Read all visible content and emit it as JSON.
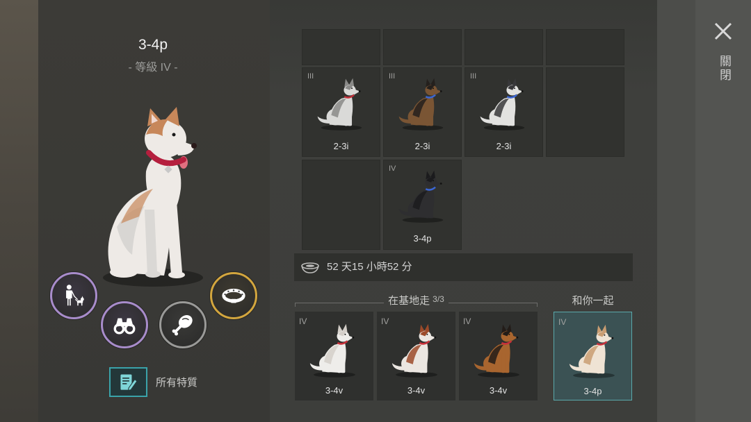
{
  "selected_dog": {
    "name": "3-4p",
    "level": "- 等級 IV -",
    "coat": "#eeeae6",
    "accent": "#c7875a",
    "collar": "#b51f3e"
  },
  "actions": [
    {
      "icon": "walk-with-dog-icon",
      "ring": "#a88ccb",
      "fill": "#3c3742"
    },
    {
      "icon": "binoculars-icon",
      "ring": "#a88ccb",
      "fill": "#3c3742"
    },
    {
      "icon": "meat-icon",
      "ring": "#9a9a98",
      "fill": "#3a3a38"
    },
    {
      "icon": "collar-icon",
      "ring": "#d3a63e",
      "fill": "#3e3a30"
    }
  ],
  "traits": {
    "icon": "notes-edit-icon",
    "label": "所有特質"
  },
  "kennel": {
    "rows": [
      [
        {
          "empty": true
        },
        {
          "empty": true
        },
        {
          "empty": true
        },
        {
          "empty": true
        }
      ],
      [
        {
          "tier": "III",
          "name": "2-3i",
          "coat": "#dadad8",
          "accent": "#8a8a88",
          "collar": "#c0303a"
        },
        {
          "tier": "III",
          "name": "2-3i",
          "coat": "#7a5534",
          "accent": "#24201d",
          "collar": "#3b66d4"
        },
        {
          "tier": "III",
          "name": "2-3i",
          "coat": "#e2e2e0",
          "accent": "#38383a",
          "collar": "#3b66d4"
        },
        {
          "empty": true
        }
      ],
      [
        {
          "empty": true
        },
        {
          "tier": "IV",
          "name": "3-4p",
          "coat": "#2e2e30",
          "accent": "#1b1b1d",
          "collar": "#3b66d4"
        }
      ]
    ]
  },
  "food": {
    "icon": "food-bowl-icon",
    "time_left": "52 天15 小時52 分"
  },
  "walking": {
    "label": "在基地走",
    "count": "3/3",
    "dogs": [
      {
        "tier": "IV",
        "name": "3-4v",
        "coat": "#eeedea",
        "accent": "#d4cfc9",
        "collar": "#c8303a"
      },
      {
        "tier": "IV",
        "name": "3-4v",
        "coat": "#ebe6e1",
        "accent": "#9c4a2a",
        "collar": "#c8303a"
      },
      {
        "tier": "IV",
        "name": "3-4v",
        "coat": "#a8652f",
        "accent": "#231c18",
        "collar": "#c8303a"
      }
    ]
  },
  "with_you": {
    "label": "和你一起",
    "dog": {
      "tier": "IV",
      "name": "3-4p",
      "coat": "#efe3d4",
      "accent": "#c99d72",
      "collar": "#c8303a"
    }
  },
  "close": {
    "icon": "close-icon",
    "label": "關閉"
  }
}
